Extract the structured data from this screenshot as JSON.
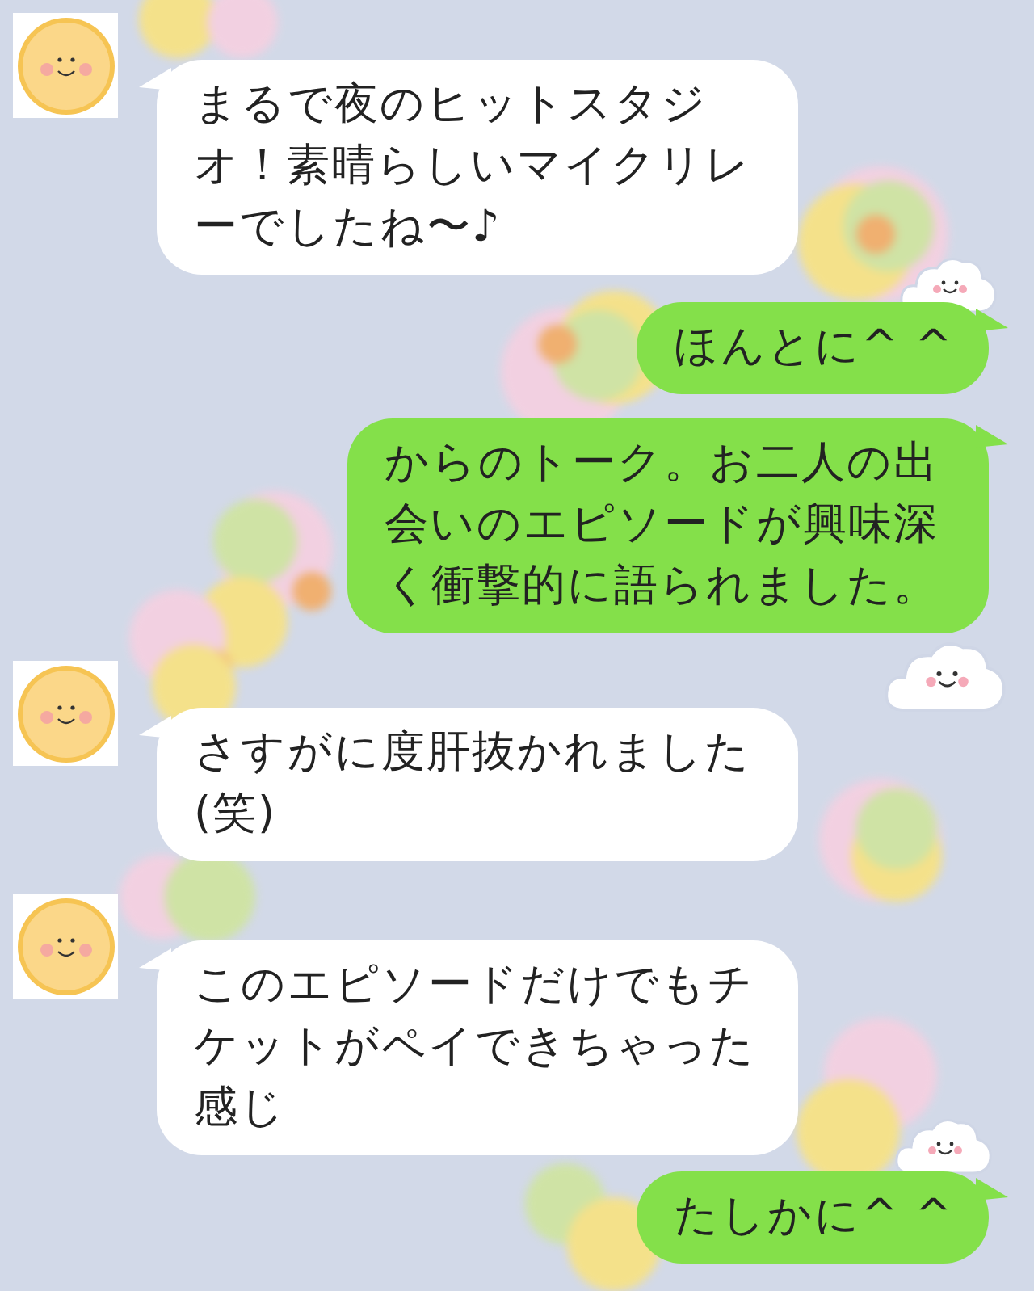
{
  "messages": [
    {
      "kind": "received",
      "text": "まるで夜のヒットスタジオ！素晴らしいマイクリレーでしたね〜♪",
      "avatar": true
    },
    {
      "kind": "sent",
      "text": "ほんとに^ ^"
    },
    {
      "kind": "sent",
      "text": "からのトーク。お二人の出会いのエピソードが興味深く衝撃的に語られました。"
    },
    {
      "kind": "received",
      "text": "さすがに度肝抜かれました(笑)",
      "avatar": true
    },
    {
      "kind": "received",
      "text": "このエピソードだけでもチケットがペイできちゃった感じ",
      "avatar": true
    },
    {
      "kind": "sent",
      "text": "たしかに^ ^"
    }
  ]
}
